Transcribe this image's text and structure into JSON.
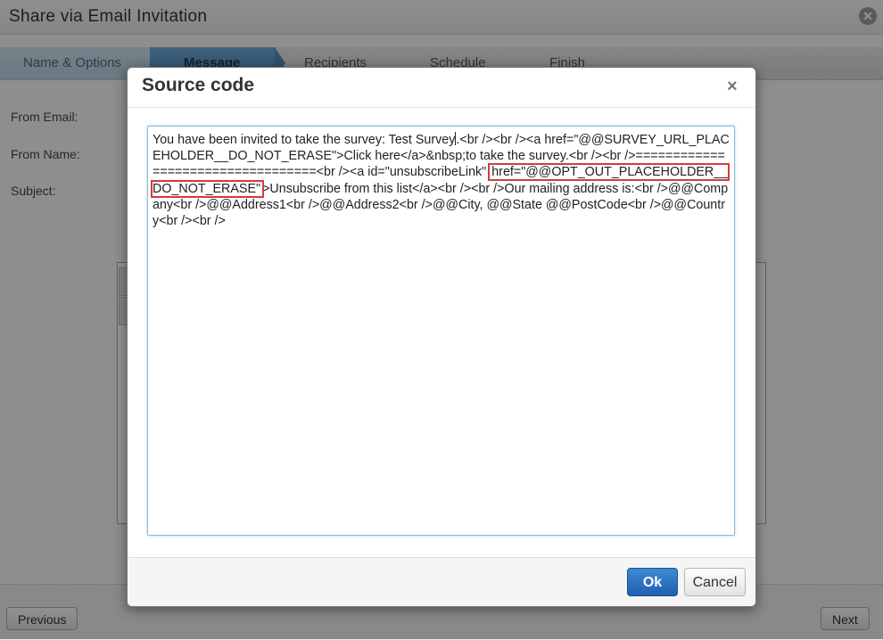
{
  "window": {
    "title": "Share via Email Invitation",
    "close_glyph": "✕"
  },
  "wizard_steps": [
    {
      "label": "Name & Options",
      "state": "done"
    },
    {
      "label": "Message",
      "state": "active"
    },
    {
      "label": "Recipients",
      "state": "pending"
    },
    {
      "label": "Schedule",
      "state": "pending"
    },
    {
      "label": "Finish",
      "state": "pending"
    }
  ],
  "form": {
    "from_email_label": "From Email:",
    "from_name_label": "From Name:",
    "subject_label": "Subject:"
  },
  "nav": {
    "previous_label": "Previous",
    "next_label": "Next"
  },
  "modal": {
    "title": "Source code",
    "close_glyph": "×",
    "code_before_caret": "You have been invited to take the survey: Test Survey",
    "code_mid": ".<br /><br /><a href=\"@@SURVEY_URL_PLACEHOLDER__DO_NOT_ERASE\">Click here</a>&nbsp;to take the survey.<br /><br />==================================<br /><a id=\"unsubscribeLink\" ",
    "code_highlight": "href=\"@@OPT_OUT_PLACEHOLDER__DO_NOT_ERASE\"",
    "code_after": ">Unsubscribe from this list</a><br /><br />Our mailing address is:<br />@@Company<br />@@Address1<br />@@Address2<br />@@City, @@State @@PostCode<br />@@Country<br /><br />",
    "ok_label": "Ok",
    "cancel_label": "Cancel"
  },
  "colors": {
    "highlight_border": "#d43b3b",
    "ok_button": "#2a6fc2",
    "active_step": "#5b97c8"
  }
}
